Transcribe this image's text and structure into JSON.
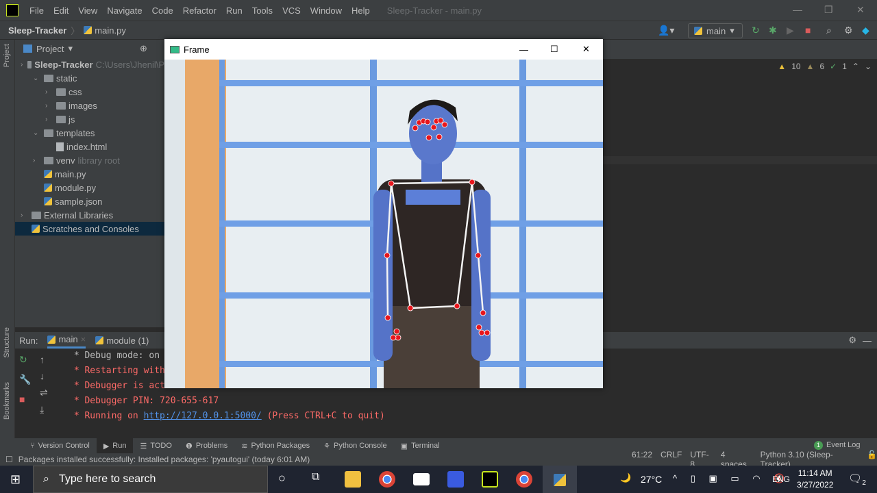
{
  "menubar": {
    "items": [
      "File",
      "Edit",
      "View",
      "Navigate",
      "Code",
      "Refactor",
      "Run",
      "Tools",
      "VCS",
      "Window",
      "Help"
    ],
    "window_title": "Sleep-Tracker - main.py"
  },
  "navbar": {
    "project": "Sleep-Tracker",
    "file": "main.py",
    "run_config": "main"
  },
  "inspections": {
    "warnings": "10",
    "weak_warnings": "6",
    "typos": "1"
  },
  "project_panel": {
    "title": "Project",
    "tree": [
      {
        "label": "Sleep-Tracker",
        "extra": "C:\\Users\\Jhenil\\P",
        "indent": 0,
        "type": "root"
      },
      {
        "label": "static",
        "indent": 1,
        "type": "folder"
      },
      {
        "label": "css",
        "indent": 2,
        "type": "folder"
      },
      {
        "label": "images",
        "indent": 2,
        "type": "folder"
      },
      {
        "label": "js",
        "indent": 2,
        "type": "folder"
      },
      {
        "label": "templates",
        "indent": 1,
        "type": "folder"
      },
      {
        "label": "index.html",
        "indent": 2,
        "type": "html"
      },
      {
        "label": "venv",
        "extra": "library root",
        "indent": 1,
        "type": "folder"
      },
      {
        "label": "main.py",
        "indent": 1,
        "type": "py"
      },
      {
        "label": "module.py",
        "indent": 1,
        "type": "py"
      },
      {
        "label": "sample.json",
        "indent": 1,
        "type": "json"
      },
      {
        "label": "External Libraries",
        "indent": 0,
        "type": "lib"
      },
      {
        "label": "Scratches and Consoles",
        "indent": 0,
        "type": "scratch",
        "selected": true
      }
    ]
  },
  "side_labels": {
    "project": "Project",
    "structure": "Structure",
    "bookmarks": "Bookmarks"
  },
  "run_panel": {
    "label": "Run:",
    "tabs": [
      "main",
      "module (1)"
    ],
    "console": [
      {
        "text": " * Debug mode: on",
        "color": "white"
      },
      {
        "text": " * Restarting with",
        "color": "red"
      },
      {
        "text": " * Debugger is acti",
        "color": "red"
      },
      {
        "text": " * Debugger PIN: 720-655-617",
        "color": "red"
      }
    ],
    "running_prefix": " * Running on ",
    "running_link": "http://127.0.0.1:5000/",
    "running_suffix": " (Press CTRL+C to quit)"
  },
  "frame_window": {
    "title": "Frame"
  },
  "tool_windows": [
    "Version Control",
    "Run",
    "TODO",
    "Problems",
    "Python Packages",
    "Python Console",
    "Terminal"
  ],
  "event_log": {
    "label": "Event Log",
    "count": "1"
  },
  "statusbar": {
    "message": "Packages installed successfully: Installed packages: 'pyautogui' (today 6:01 AM)",
    "position": "61:22",
    "line_sep": "CRLF",
    "encoding": "UTF-8",
    "indent": "4 spaces",
    "interpreter": "Python 3.10 (Sleep-Tracker)"
  },
  "taskbar": {
    "search_placeholder": "Type here to search",
    "weather": "27°C",
    "lang": "ENG",
    "time": "11:14 AM",
    "date": "3/27/2022",
    "notifications": "2"
  }
}
